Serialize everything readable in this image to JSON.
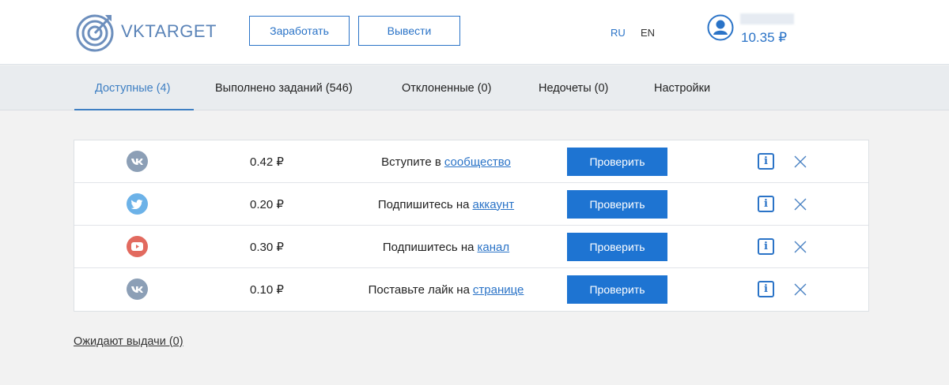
{
  "header": {
    "logo_text": "VKTARGET",
    "earn_label": "Заработать",
    "withdraw_label": "Вывести",
    "lang_ru": "RU",
    "lang_en": "EN",
    "balance": "10.35 ₽"
  },
  "tabs": [
    {
      "label": "Доступные (4)",
      "active": true
    },
    {
      "label": "Выполнено заданий (546)",
      "active": false
    },
    {
      "label": "Отклоненные (0)",
      "active": false
    },
    {
      "label": "Недочеты (0)",
      "active": false
    },
    {
      "label": "Настройки",
      "active": false
    }
  ],
  "tasks": [
    {
      "service": "vk-icon",
      "service_color": "#8c9fb6",
      "price": "0.42 ₽",
      "text": "Вступите в",
      "link": "сообщество",
      "button": "Проверить"
    },
    {
      "service": "twitter-icon",
      "service_color": "#6cb2e8",
      "price": "0.20 ₽",
      "text": "Подпишитесь на",
      "link": "аккаунт",
      "button": "Проверить"
    },
    {
      "service": "youtube-icon",
      "service_color": "#e26a5f",
      "price": "0.30 ₽",
      "text": "Подпишитесь на",
      "link": "канал",
      "button": "Проверить"
    },
    {
      "service": "vk-icon",
      "service_color": "#8c9fb6",
      "price": "0.10 ₽",
      "text": "Поставьте лайк на",
      "link": "странице",
      "button": "Проверить"
    }
  ],
  "pending_link": "Ожидают выдачи (0)",
  "colors": {
    "accent": "#1e74d2",
    "link": "#2a73c7",
    "tab_bar": "#e9ecef",
    "background": "#f2f2f2"
  }
}
